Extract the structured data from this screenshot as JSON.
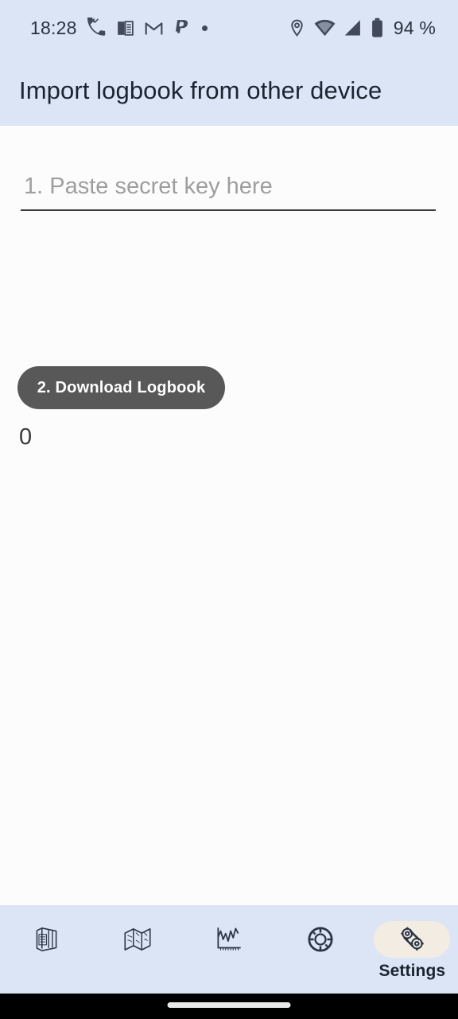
{
  "statusbar": {
    "time": "18:28",
    "battery_percent": "94 %",
    "left_icons": [
      "missed-call-icon",
      "news-book-icon",
      "gmail-icon",
      "paypal-icon",
      "dot-icon"
    ],
    "right_icons": [
      "location-pin-icon",
      "wifi-icon",
      "cellular-signal-icon",
      "battery-icon"
    ],
    "bg_color": "#dbe5f5"
  },
  "appbar": {
    "title": "Import logbook from other device",
    "bg_color": "#dbe5f5",
    "text_color": "#1b2430"
  },
  "main": {
    "secret_key_field": {
      "placeholder": "1. Paste secret key here",
      "value": ""
    },
    "download_button": {
      "label": "2. Download Logbook",
      "bg_color": "#585858",
      "text_color": "#ffffff"
    },
    "status_count": "0",
    "bg_color": "#fcfcfd"
  },
  "bottomnav": {
    "bg_color": "#dbe5f5",
    "active_pill_color": "#f2ece3",
    "items": [
      {
        "name": "logbook",
        "icon": "logbook-icon",
        "label": "",
        "active": false
      },
      {
        "name": "map",
        "icon": "map-icon",
        "label": "",
        "active": false
      },
      {
        "name": "chart",
        "icon": "chart-icon",
        "label": "",
        "active": false
      },
      {
        "name": "lifebuoy",
        "icon": "lifebuoy-icon",
        "label": "",
        "active": false
      },
      {
        "name": "settings",
        "icon": "gears-icon",
        "label": "Settings",
        "active": true
      }
    ]
  },
  "gesturebar": {
    "bg_color": "#000000",
    "indicator_color": "#e8e8e8"
  }
}
